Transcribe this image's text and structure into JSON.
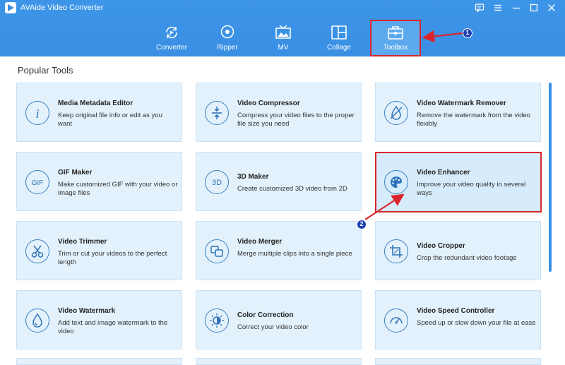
{
  "app": {
    "title": "AVAide Video Converter"
  },
  "nav": {
    "tabs": [
      {
        "label": "Converter",
        "icon": "converter-icon"
      },
      {
        "label": "Ripper",
        "icon": "ripper-icon"
      },
      {
        "label": "MV",
        "icon": "mv-icon"
      },
      {
        "label": "Collage",
        "icon": "collage-icon"
      },
      {
        "label": "Toolbox",
        "icon": "toolbox-icon",
        "active": true
      }
    ]
  },
  "section": {
    "title": "Popular Tools"
  },
  "tools": [
    {
      "name": "Media Metadata Editor",
      "desc": "Keep original file info or edit as you want",
      "icon": "info-icon"
    },
    {
      "name": "Video Compressor",
      "desc": "Compress your video files to the proper file size you need",
      "icon": "compress-icon"
    },
    {
      "name": "Video Watermark Remover",
      "desc": "Remove the watermark from the video flexibly",
      "icon": "watermark-remove-icon"
    },
    {
      "name": "GIF Maker",
      "desc": "Make customized GIF with your video or image files",
      "icon": "gif-icon"
    },
    {
      "name": "3D Maker",
      "desc": "Create customized 3D video from 2D",
      "icon": "3d-icon"
    },
    {
      "name": "Video Enhancer",
      "desc": "Improve your video quality in several ways",
      "icon": "palette-icon",
      "highlighted": true
    },
    {
      "name": "Video Trimmer",
      "desc": "Trim or cut your videos to the perfect length",
      "icon": "scissors-icon"
    },
    {
      "name": "Video Merger",
      "desc": "Merge multiple clips into a single piece",
      "icon": "merge-icon"
    },
    {
      "name": "Video Cropper",
      "desc": "Crop the redundant video footage",
      "icon": "crop-icon"
    },
    {
      "name": "Video Watermark",
      "desc": "Add text and image watermark to the video",
      "icon": "drop-icon"
    },
    {
      "name": "Color Correction",
      "desc": "Correct your video color",
      "icon": "color-correction-icon"
    },
    {
      "name": "Video Speed Controller",
      "desc": "Speed up or slow down your file at ease",
      "icon": "speedometer-icon"
    }
  ],
  "annotations": {
    "marker1": "1",
    "marker2": "2"
  },
  "colors": {
    "header": "#3a8fe3",
    "card": "#e3f1fc",
    "annotation": "#d9262c",
    "marker": "#1a3fb3"
  }
}
